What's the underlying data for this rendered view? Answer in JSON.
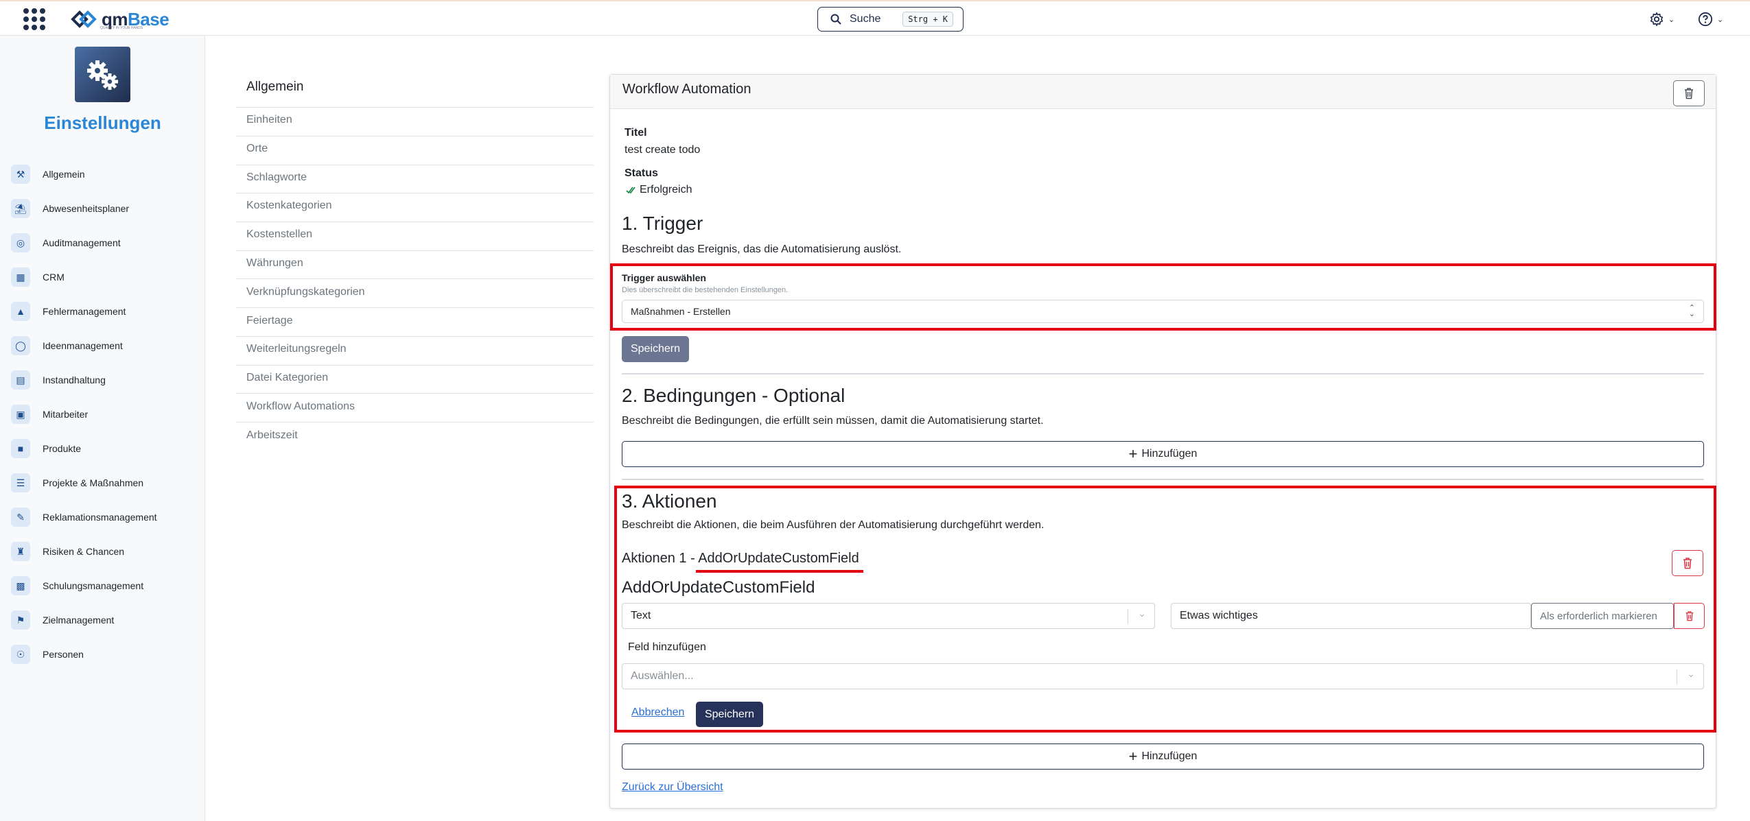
{
  "header": {
    "logo_text_part1": "qm",
    "logo_text_part2": "Base",
    "logo_tagline": "QUALITY IN YOUR HANDS",
    "search_label": "Suche",
    "search_shortcut": "Strg + K"
  },
  "sidebar": {
    "title": "Einstellungen",
    "items": [
      {
        "label": "Allgemein",
        "icon": "tools-icon"
      },
      {
        "label": "Abwesenheitsplaner",
        "icon": "beach-icon"
      },
      {
        "label": "Auditmanagement",
        "icon": "audit-icon"
      },
      {
        "label": "CRM",
        "icon": "contacts-icon"
      },
      {
        "label": "Fehlermanagement",
        "icon": "warning-icon"
      },
      {
        "label": "Ideenmanagement",
        "icon": "lightbulb-icon"
      },
      {
        "label": "Instandhaltung",
        "icon": "maintenance-icon"
      },
      {
        "label": "Mitarbeiter",
        "icon": "id-card-icon"
      },
      {
        "label": "Produkte",
        "icon": "box-icon"
      },
      {
        "label": "Projekte & Maßnahmen",
        "icon": "list-icon"
      },
      {
        "label": "Reklamationsmanagement",
        "icon": "complaint-icon"
      },
      {
        "label": "Risiken & Chancen",
        "icon": "chess-icon"
      },
      {
        "label": "Schulungsmanagement",
        "icon": "training-icon"
      },
      {
        "label": "Zielmanagement",
        "icon": "flag-icon"
      },
      {
        "label": "Personen",
        "icon": "person-icon"
      }
    ]
  },
  "settings_menu": {
    "heading": "Allgemein",
    "items": [
      "Einheiten",
      "Orte",
      "Schlagworte",
      "Kostenkategorien",
      "Kostenstellen",
      "Währungen",
      "Verknüpfungskategorien",
      "Feiertage",
      "Weiterleitungsregeln",
      "Datei Kategorien",
      "Workflow Automations",
      "Arbeitszeit"
    ]
  },
  "card": {
    "title": "Workflow Automation",
    "titel_label": "Titel",
    "titel_value": "test create todo",
    "status_label": "Status",
    "status_value": "Erfolgreich",
    "trigger": {
      "heading": "1. Trigger",
      "description": "Beschreibt das Ereignis, das die Automatisierung auslöst.",
      "select_label": "Trigger auswählen",
      "select_hint": "Dies überschreibt die bestehenden Einstellungen.",
      "select_value": "Maßnahmen - Erstellen",
      "save_label": "Speichern"
    },
    "conditions": {
      "heading": "2. Bedingungen - Optional",
      "description": "Beschreibt die Bedingungen, die erfüllt sein müssen, damit die Automatisierung startet.",
      "add_label": "Hinzufügen"
    },
    "actions": {
      "heading": "3. Aktionen",
      "description": "Beschreibt die Aktionen, die beim Ausführen der Automatisierung durchgeführt werden.",
      "action_title_prefix": "Aktionen 1 - ",
      "action_title_name": "AddOrUpdateCustomField",
      "action_subheading": "AddOrUpdateCustomField",
      "field_select_value": "Text",
      "field_value": "Etwas wichtiges",
      "required_button": "Als erforderlich markieren",
      "add_field_label": "Feld hinzufügen",
      "add_field_placeholder": "Auswählen...",
      "cancel_label": "Abbrechen",
      "save_label": "Speichern",
      "add_label": "Hinzufügen"
    },
    "back_link": "Zurück zur Übersicht"
  }
}
